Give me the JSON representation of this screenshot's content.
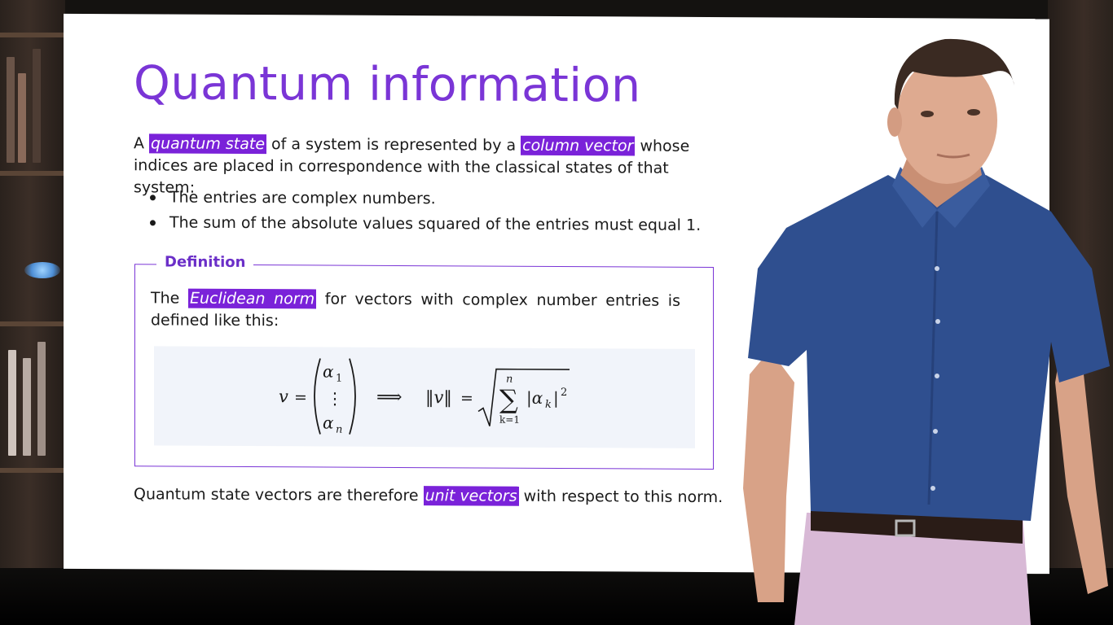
{
  "slide": {
    "title": "Quantum information",
    "intro": {
      "t1": "A ",
      "h1": "quantum state",
      "t2": " of a system is represented by a ",
      "h2": "column vector",
      "t3": " whose indices are placed in correspondence with the classical states of that system:"
    },
    "bullets": [
      "The entries are complex numbers.",
      "The sum of the absolute values squared of the entries must equal 1."
    ],
    "definition": {
      "label": "Definition",
      "t1": "The ",
      "h1": "Euclidean norm",
      "t2": " for vectors with complex number entries is defined like this:"
    },
    "formula": {
      "v": "v",
      "eq": "=",
      "a1": "α",
      "sub1": "1",
      "vdots": "⋮",
      "an": "α",
      "subn": "n",
      "implies": "⟹",
      "norm": "‖v‖",
      "eq2": "=",
      "sum_top": "n",
      "sigma": "∑",
      "sum_bottom": "k=1",
      "abs": "|α",
      "subk": "k",
      "abs_close": "|",
      "sup2": "2"
    },
    "conclusion": {
      "t1": "Quantum state vectors are therefore ",
      "h1": "unit vectors",
      "t2": " with respect to this norm."
    }
  },
  "colors": {
    "accent": "#7a22d9",
    "title": "#7a35d6",
    "shirt": "#2f4f8f",
    "pants": "#d8b9d6"
  }
}
